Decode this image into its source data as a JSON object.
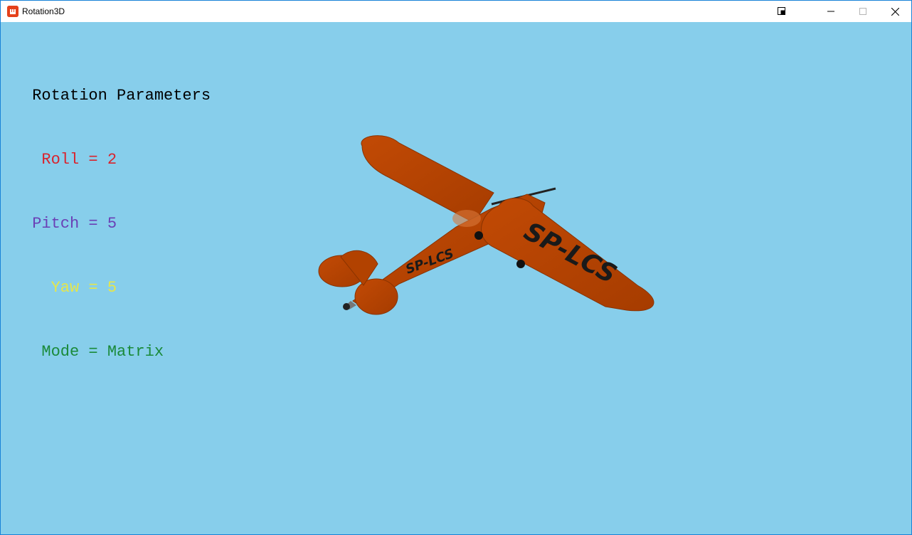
{
  "window": {
    "title": "Rotation3D",
    "border_color": "#1883d7",
    "background_color": "#87ceeb"
  },
  "hud": {
    "heading": " Rotation Parameters",
    "roll": "  Roll = 2",
    "pitch": " Pitch = 5",
    "yaw": "   Yaw = 5",
    "mode": "  Mode = Matrix",
    "colors": {
      "heading": "#000000",
      "roll": "#d9232d",
      "pitch": "#6a3fb5",
      "yaw": "#e6e64a",
      "mode": "#1a8a3a"
    }
  },
  "model": {
    "wing_registration": "SP-LCS",
    "fuselage_registration": "SP-LCS",
    "body_color": "#b84300"
  },
  "icons": {
    "app": "monogame-app-icon",
    "snap": "snap-layout-icon",
    "minimize": "minimize-icon",
    "maximize": "maximize-icon",
    "close": "close-icon"
  }
}
